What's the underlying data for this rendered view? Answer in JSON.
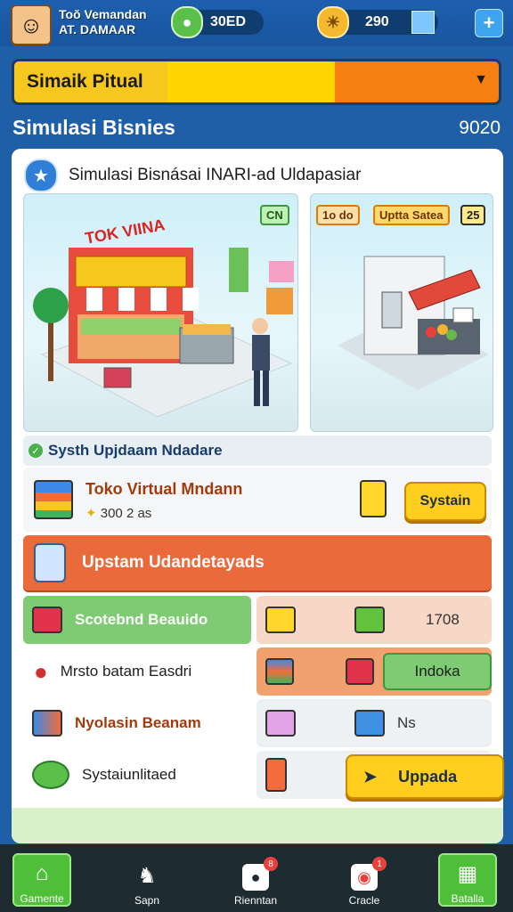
{
  "header": {
    "player_name": "Toŏ Vemandan",
    "player_sub": "AT. DAMAAR",
    "coins": "30ED",
    "gems": "290",
    "plus_label": "+"
  },
  "dropdown": {
    "label": "Simaik Pitual"
  },
  "section": {
    "title": "Simulasi Bisnies",
    "value": "9020"
  },
  "panel": {
    "title": "Simulasi Bisnásai INARI-ad Uldapasiar",
    "store_tag": "CN",
    "store_sign": "TOK VIINA",
    "side_tag_a": "1o do",
    "side_tag_b": "Uptta Satea",
    "side_tag_c": "25"
  },
  "green_bar": {
    "label": "Systh Upjdaam Ndadare"
  },
  "shop": {
    "name": "Toko Virtual Mndann",
    "meta": "300 2 as",
    "button": "Systain"
  },
  "orange_bar": {
    "label": "Upstam Udandetayads"
  },
  "rows": [
    {
      "left": "Scotebnd Beauido",
      "right": "1708"
    },
    {
      "left": "Mrsto batam Easdri",
      "right": "Indoka"
    },
    {
      "left": "Nyolasin Beanam",
      "right": "Ns"
    },
    {
      "left": "Systaiunlitaed",
      "right": "Uppada"
    }
  ],
  "nav": [
    {
      "label": "Gamente"
    },
    {
      "label": "Sapn"
    },
    {
      "label": "Rienntan",
      "badge": "8"
    },
    {
      "label": "Cracle",
      "badge": "1"
    },
    {
      "label": "Batalla"
    }
  ],
  "colors": {
    "header_blue": "#1d5fae",
    "dropdown_yellow": "#f6c81f",
    "dropdown_orange": "#f77f10",
    "orange_bar": "#ea6a3b",
    "green_row": "#7ecb73",
    "salmon_row": "#f7d7c6",
    "button_yellow": "#ffce1f",
    "nav_active": "#4fbf3a"
  }
}
